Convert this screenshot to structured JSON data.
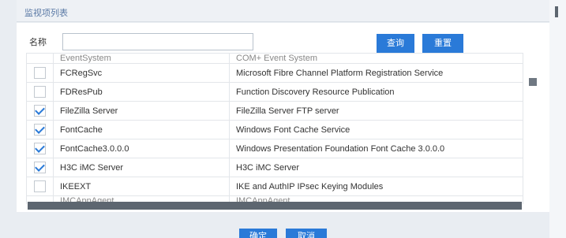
{
  "dialog": {
    "title": "监视项列表"
  },
  "filter": {
    "name_label": "名称",
    "name_value": "",
    "query_label": "查询",
    "reset_label": "重置"
  },
  "rows": [
    {
      "checked": false,
      "name": "EventSystem",
      "desc": "COM+ Event System",
      "partial": true
    },
    {
      "checked": false,
      "name": "FCRegSvc",
      "desc": "Microsoft Fibre Channel Platform Registration Service"
    },
    {
      "checked": false,
      "name": "FDResPub",
      "desc": "Function Discovery Resource Publication"
    },
    {
      "checked": true,
      "name": "FileZilla Server",
      "desc": "FileZilla Server FTP server"
    },
    {
      "checked": true,
      "name": "FontCache",
      "desc": "Windows Font Cache Service"
    },
    {
      "checked": true,
      "name": "FontCache3.0.0.0",
      "desc": "Windows Presentation Foundation Font Cache 3.0.0.0"
    },
    {
      "checked": true,
      "name": "H3C iMC Server",
      "desc": "H3C iMC Server"
    },
    {
      "checked": false,
      "name": "IKEEXT",
      "desc": "IKE and AuthIP IPsec Keying Modules"
    },
    {
      "checked": false,
      "name": "IMCAppAgent",
      "desc": "IMCAppAgent",
      "partial": true
    }
  ],
  "footer": {
    "ok_label": "确定",
    "cancel_label": "取消"
  },
  "colors": {
    "accent": "#2a7ad8",
    "title": "#5b7aa6"
  }
}
